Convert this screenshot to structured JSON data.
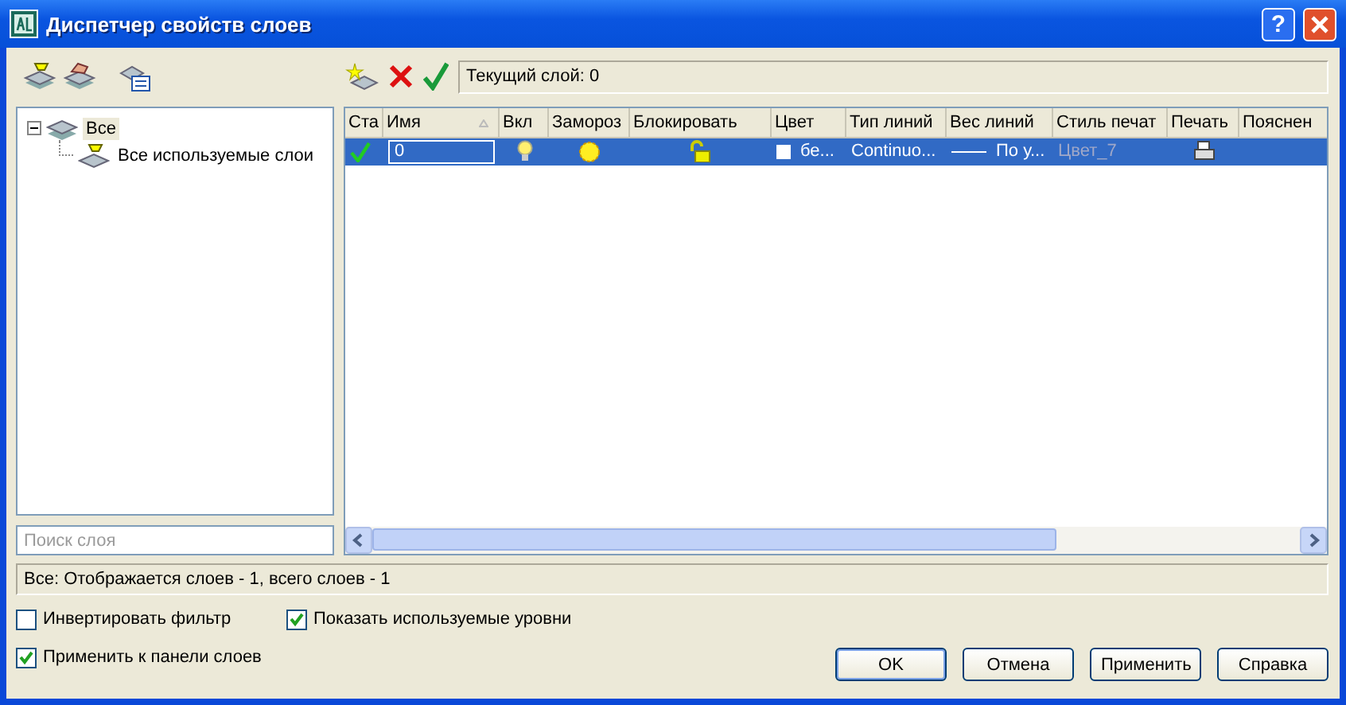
{
  "window": {
    "title": "Диспетчер свойств слоев",
    "help_button": "?"
  },
  "current_layer": "Текущий слой: 0",
  "tree": [
    {
      "label": "Все",
      "selected": true,
      "expanded": true,
      "children": [
        {
          "label": "Все используемые слои",
          "selected": false
        }
      ]
    }
  ],
  "search": {
    "placeholder": "Поиск слоя"
  },
  "table": {
    "columns": [
      {
        "label": "Ста",
        "sorted": false
      },
      {
        "label": "Имя",
        "sorted": true
      },
      {
        "label": "Вкл",
        "sorted": false
      },
      {
        "label": "Замороз",
        "sorted": false
      },
      {
        "label": "Блокировать",
        "sorted": false
      },
      {
        "label": "Цвет",
        "sorted": false
      },
      {
        "label": "Тип линий",
        "sorted": false
      },
      {
        "label": "Вес линий",
        "sorted": false
      },
      {
        "label": "Стиль печат",
        "sorted": false
      },
      {
        "label": "Печать",
        "sorted": false
      },
      {
        "label": "Пояснен",
        "sorted": false
      }
    ],
    "rows": [
      {
        "selected": true,
        "current": true,
        "name": "0",
        "on": true,
        "frozen": false,
        "locked": false,
        "color": "#ffffff",
        "color_name": "бе...",
        "linetype": "Continuo...",
        "lineweight": "По у...",
        "plot_style": "Цвет_7",
        "plot_style_enabled": false,
        "plot": true
      }
    ]
  },
  "status_bar": "Все: Отображается слоев - 1, всего слоев - 1",
  "checkboxes": [
    {
      "label": "Инвертировать фильтр",
      "checked": false
    },
    {
      "label": "Показать используемые уровни",
      "checked": true
    },
    {
      "label": "Применить к панели слоев",
      "checked": true
    }
  ],
  "buttons": [
    {
      "label": "OK",
      "default": true
    },
    {
      "label": "Отмена",
      "default": false
    },
    {
      "label": "Применить",
      "default": false
    },
    {
      "label": "Справка",
      "default": false
    }
  ]
}
